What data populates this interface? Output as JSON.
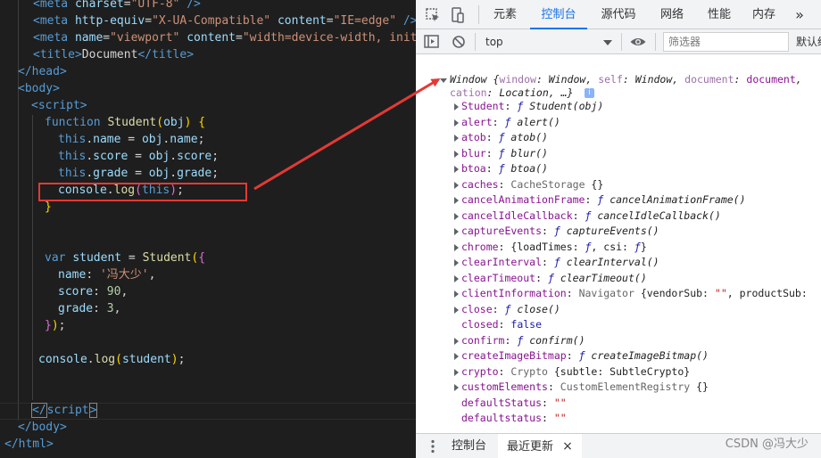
{
  "editor": {
    "lines": [
      {
        "segs": [
          [
            "t-tag",
            "<meta "
          ],
          [
            "t-attr",
            "charset"
          ],
          [
            "t-txt",
            "="
          ],
          [
            "t-str",
            "\"UTF-8\""
          ],
          [
            "t-tag",
            " />"
          ]
        ]
      },
      {
        "segs": [
          [
            "t-tag",
            "<meta "
          ],
          [
            "t-attr",
            "http-equiv"
          ],
          [
            "t-txt",
            "="
          ],
          [
            "t-str",
            "\"X-UA-Compatible\""
          ],
          [
            "t-txt",
            " "
          ],
          [
            "t-attr",
            "content"
          ],
          [
            "t-txt",
            "="
          ],
          [
            "t-str",
            "\"IE=edge\""
          ],
          [
            "t-tag",
            " />"
          ]
        ]
      },
      {
        "segs": [
          [
            "t-tag",
            "<meta "
          ],
          [
            "t-attr",
            "name"
          ],
          [
            "t-txt",
            "="
          ],
          [
            "t-str",
            "\"viewport\""
          ],
          [
            "t-txt",
            " "
          ],
          [
            "t-attr",
            "content"
          ],
          [
            "t-txt",
            "="
          ],
          [
            "t-str",
            "\"width=device-width, initi"
          ]
        ]
      },
      {
        "segs": [
          [
            "t-tag",
            "<title>"
          ],
          [
            "t-txt",
            "Document"
          ],
          [
            "t-tag",
            "</title>"
          ]
        ]
      },
      {
        "segs": [
          [
            "t-tag",
            "</head>"
          ]
        ]
      },
      {
        "segs": [
          [
            "t-tag",
            "<body>"
          ]
        ]
      },
      {
        "segs": [
          [
            "t-tag",
            "<script>"
          ]
        ]
      },
      {
        "segs": [
          [
            "t-kw",
            "function "
          ],
          [
            "t-fn",
            "Student"
          ],
          [
            "t-br1",
            "("
          ],
          [
            "t-var",
            "obj"
          ],
          [
            "t-br1",
            ")"
          ],
          [
            "t-pn",
            " "
          ],
          [
            "t-br1",
            "{"
          ]
        ]
      },
      {
        "segs": [
          [
            "t-kw",
            "this"
          ],
          [
            "t-pn",
            "."
          ],
          [
            "t-var",
            "name"
          ],
          [
            "t-pn",
            " = "
          ],
          [
            "t-var",
            "obj"
          ],
          [
            "t-pn",
            "."
          ],
          [
            "t-var",
            "name"
          ],
          [
            "t-pn",
            ";"
          ]
        ]
      },
      {
        "segs": [
          [
            "t-kw",
            "this"
          ],
          [
            "t-pn",
            "."
          ],
          [
            "t-var",
            "score"
          ],
          [
            "t-pn",
            " = "
          ],
          [
            "t-var",
            "obj"
          ],
          [
            "t-pn",
            "."
          ],
          [
            "t-var",
            "score"
          ],
          [
            "t-pn",
            ";"
          ]
        ]
      },
      {
        "segs": [
          [
            "t-kw",
            "this"
          ],
          [
            "t-pn",
            "."
          ],
          [
            "t-var",
            "grade"
          ],
          [
            "t-pn",
            " = "
          ],
          [
            "t-var",
            "obj"
          ],
          [
            "t-pn",
            "."
          ],
          [
            "t-var",
            "grade"
          ],
          [
            "t-pn",
            ";"
          ]
        ]
      },
      {
        "segs": [
          [
            "t-var",
            "console"
          ],
          [
            "t-pn",
            "."
          ],
          [
            "t-fn",
            "log"
          ],
          [
            "t-br2",
            "("
          ],
          [
            "t-kw",
            "this"
          ],
          [
            "t-br2",
            ")"
          ],
          [
            "t-pn",
            ";"
          ]
        ]
      },
      {
        "segs": [
          [
            "t-br1",
            "}"
          ]
        ]
      },
      {
        "segs": []
      },
      {
        "segs": []
      },
      {
        "segs": [
          [
            "t-kw",
            "var "
          ],
          [
            "t-var",
            "student"
          ],
          [
            "t-pn",
            " = "
          ],
          [
            "t-fn",
            "Student"
          ],
          [
            "t-br1",
            "("
          ],
          [
            "t-br2",
            "{"
          ]
        ]
      },
      {
        "segs": [
          [
            "t-var",
            "name"
          ],
          [
            "t-pn",
            ": "
          ],
          [
            "t-str",
            "'冯大少'"
          ],
          [
            "t-pn",
            ","
          ]
        ]
      },
      {
        "segs": [
          [
            "t-var",
            "score"
          ],
          [
            "t-pn",
            ": "
          ],
          [
            "t-num",
            "90"
          ],
          [
            "t-pn",
            ","
          ]
        ]
      },
      {
        "segs": [
          [
            "t-var",
            "grade"
          ],
          [
            "t-pn",
            ": "
          ],
          [
            "t-num",
            "3"
          ],
          [
            "t-pn",
            ","
          ]
        ]
      },
      {
        "segs": [
          [
            "t-br2",
            "}"
          ],
          [
            "t-br1",
            ")"
          ],
          [
            "t-pn",
            ";"
          ]
        ]
      },
      {
        "segs": []
      },
      {
        "segs": [
          [
            "t-var",
            "console"
          ],
          [
            "t-pn",
            "."
          ],
          [
            "t-fn",
            "log"
          ],
          [
            "t-br1",
            "("
          ],
          [
            "t-var",
            "student"
          ],
          [
            "t-br1",
            ")"
          ],
          [
            "t-pn",
            ";"
          ]
        ]
      },
      {
        "segs": []
      },
      {
        "segs": []
      },
      {
        "segs": [
          [
            "match",
            "</"
          ],
          [
            "t-tag",
            "script"
          ],
          [
            "match",
            ">"
          ]
        ]
      },
      {
        "segs": [
          [
            "t-tag",
            "</body>"
          ]
        ]
      },
      {
        "segs": [
          [
            "t-tag",
            "</html>"
          ]
        ]
      }
    ]
  },
  "devtools": {
    "tabs": [
      "元素",
      "控制台",
      "源代码",
      "网络",
      "性能",
      "内存"
    ],
    "active_tab": "控制台",
    "more_label": "»",
    "context": "top",
    "filter_placeholder": "筛选器",
    "levels_label": "默认级",
    "console": {
      "header_line1": [
        [
          "it",
          "Window {"
        ],
        [
          "kg",
          "window"
        ],
        [
          "it",
          ": Window, "
        ],
        [
          "kg",
          "self"
        ],
        [
          "it",
          ": Window, "
        ],
        [
          "kg",
          "document"
        ],
        [
          "it",
          ": "
        ],
        [
          "k",
          "document"
        ],
        [
          "it",
          ","
        ]
      ],
      "header_line2": [
        [
          "kg",
          "cation"
        ],
        [
          "it",
          ": Location, …}"
        ]
      ],
      "info_glyph": "i",
      "props": [
        {
          "expand": true,
          "segs": [
            [
              "k",
              "Student"
            ],
            [
              "plain",
              ": "
            ],
            [
              "f",
              "ƒ "
            ],
            [
              "fx",
              "Student(obj)"
            ]
          ]
        },
        {
          "expand": true,
          "segs": [
            [
              "k",
              "alert"
            ],
            [
              "plain",
              ": "
            ],
            [
              "f",
              "ƒ "
            ],
            [
              "fx",
              "alert()"
            ]
          ]
        },
        {
          "expand": true,
          "segs": [
            [
              "k",
              "atob"
            ],
            [
              "plain",
              ": "
            ],
            [
              "f",
              "ƒ "
            ],
            [
              "fx",
              "atob()"
            ]
          ]
        },
        {
          "expand": true,
          "segs": [
            [
              "k",
              "blur"
            ],
            [
              "plain",
              ": "
            ],
            [
              "f",
              "ƒ "
            ],
            [
              "fx",
              "blur()"
            ]
          ]
        },
        {
          "expand": true,
          "segs": [
            [
              "k",
              "btoa"
            ],
            [
              "plain",
              ": "
            ],
            [
              "f",
              "ƒ "
            ],
            [
              "fx",
              "btoa()"
            ]
          ]
        },
        {
          "expand": true,
          "segs": [
            [
              "k",
              "caches"
            ],
            [
              "plain",
              ": "
            ],
            [
              "cl",
              "CacheStorage "
            ],
            [
              "plain",
              "{}"
            ]
          ]
        },
        {
          "expand": true,
          "segs": [
            [
              "k",
              "cancelAnimationFrame"
            ],
            [
              "plain",
              ": "
            ],
            [
              "f",
              "ƒ "
            ],
            [
              "fx",
              "cancelAnimationFrame()"
            ]
          ]
        },
        {
          "expand": true,
          "segs": [
            [
              "k",
              "cancelIdleCallback"
            ],
            [
              "plain",
              ": "
            ],
            [
              "f",
              "ƒ "
            ],
            [
              "fx",
              "cancelIdleCallback()"
            ]
          ]
        },
        {
          "expand": true,
          "segs": [
            [
              "k",
              "captureEvents"
            ],
            [
              "plain",
              ": "
            ],
            [
              "f",
              "ƒ "
            ],
            [
              "fx",
              "captureEvents()"
            ]
          ]
        },
        {
          "expand": true,
          "segs": [
            [
              "k",
              "chrome"
            ],
            [
              "plain",
              ": {loadTimes: "
            ],
            [
              "f",
              "ƒ"
            ],
            [
              "plain",
              ", csi: "
            ],
            [
              "f",
              "ƒ"
            ],
            [
              "plain",
              "}"
            ]
          ]
        },
        {
          "expand": true,
          "segs": [
            [
              "k",
              "clearInterval"
            ],
            [
              "plain",
              ": "
            ],
            [
              "f",
              "ƒ "
            ],
            [
              "fx",
              "clearInterval()"
            ]
          ]
        },
        {
          "expand": true,
          "segs": [
            [
              "k",
              "clearTimeout"
            ],
            [
              "plain",
              ": "
            ],
            [
              "f",
              "ƒ "
            ],
            [
              "fx",
              "clearTimeout()"
            ]
          ]
        },
        {
          "expand": true,
          "segs": [
            [
              "k",
              "clientInformation"
            ],
            [
              "plain",
              ": "
            ],
            [
              "cl",
              "Navigator "
            ],
            [
              "plain",
              "{vendorSub: "
            ],
            [
              "vstr",
              "\"\""
            ],
            [
              "plain",
              ", productSub:"
            ]
          ]
        },
        {
          "expand": true,
          "segs": [
            [
              "k",
              "close"
            ],
            [
              "plain",
              ": "
            ],
            [
              "f",
              "ƒ "
            ],
            [
              "fx",
              "close()"
            ]
          ]
        },
        {
          "expand": false,
          "segs": [
            [
              "k",
              "closed"
            ],
            [
              "plain",
              ": "
            ],
            [
              "vkw",
              "false"
            ]
          ]
        },
        {
          "expand": true,
          "segs": [
            [
              "k",
              "confirm"
            ],
            [
              "plain",
              ": "
            ],
            [
              "f",
              "ƒ "
            ],
            [
              "fx",
              "confirm()"
            ]
          ]
        },
        {
          "expand": true,
          "segs": [
            [
              "k",
              "createImageBitmap"
            ],
            [
              "plain",
              ": "
            ],
            [
              "f",
              "ƒ "
            ],
            [
              "fx",
              "createImageBitmap()"
            ]
          ]
        },
        {
          "expand": true,
          "segs": [
            [
              "k",
              "crypto"
            ],
            [
              "plain",
              ": "
            ],
            [
              "cl",
              "Crypto "
            ],
            [
              "plain",
              "{subtle: SubtleCrypto}"
            ]
          ]
        },
        {
          "expand": true,
          "segs": [
            [
              "k",
              "customElements"
            ],
            [
              "plain",
              ": "
            ],
            [
              "cl",
              "CustomElementRegistry "
            ],
            [
              "plain",
              "{}"
            ]
          ]
        },
        {
          "expand": false,
          "segs": [
            [
              "k",
              "defaultStatus"
            ],
            [
              "plain",
              ": "
            ],
            [
              "vstr",
              "\"\""
            ]
          ]
        },
        {
          "expand": false,
          "segs": [
            [
              "k",
              "defaultstatus"
            ],
            [
              "plain",
              ": "
            ],
            [
              "vstr",
              "\"\""
            ]
          ]
        }
      ]
    },
    "drawer": {
      "tab1": "控制台",
      "tab2": "最近更新",
      "close": "×"
    }
  },
  "watermark": "CSDN @冯大少",
  "colors": {
    "highlight_box": "#e53935",
    "arrow": "#e53935",
    "active_tab": "#1a73e8"
  }
}
